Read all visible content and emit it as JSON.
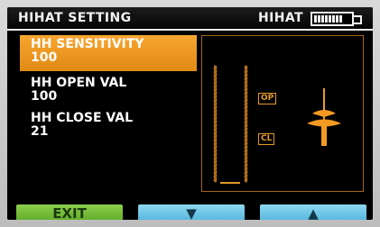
{
  "header": {
    "title": "HIHAT SETTING",
    "mode_label": "HIHAT",
    "battery_level": 0.8
  },
  "params": [
    {
      "label": "HH SENSITIVITY",
      "value": "100",
      "selected": true
    },
    {
      "label": "HH OPEN VAL",
      "value": "100",
      "selected": false
    },
    {
      "label": "HH CLOSE VAL",
      "value": "21",
      "selected": false
    }
  ],
  "visualization": {
    "open_marker": "OP",
    "close_marker": "CL"
  },
  "softkeys": {
    "exit": "EXIT",
    "down": "▼",
    "up": "▲"
  },
  "colors": {
    "accent_orange": "#f29a22",
    "exit_green": "#7bbf3c",
    "arrow_blue": "#6cc5e8"
  }
}
